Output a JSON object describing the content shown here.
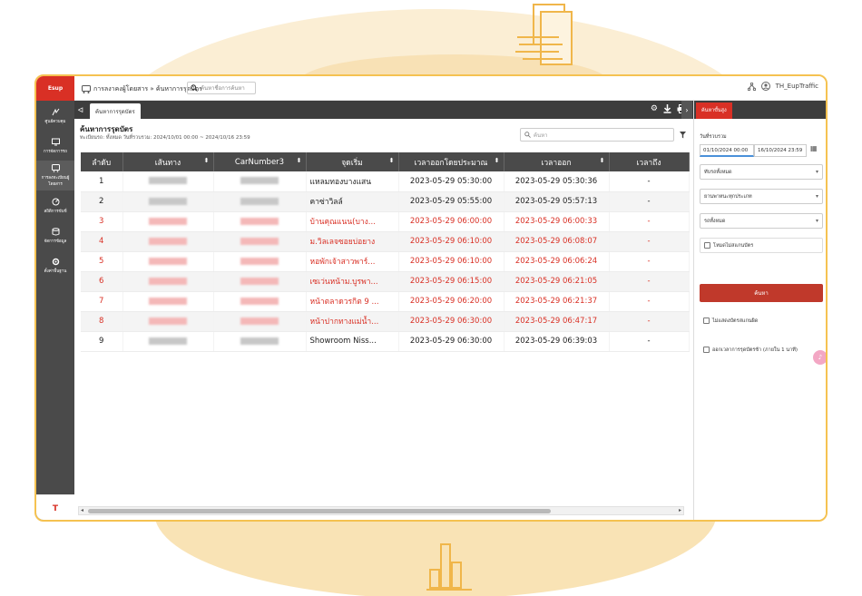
{
  "app": {
    "logo": "Esup",
    "breadcrumb": "การลงาคงผู้โดยสาร » ค้นหาการรุดบัตร",
    "top_search_placeholder": "ค้นหาชื่อการค้นหา",
    "user": "TH_EupTraffic"
  },
  "sidebar": {
    "items": [
      {
        "label": "ศูนย์ควบคุม",
        "icon": "tracking-icon"
      },
      {
        "label": "การจัดการรถ",
        "icon": "monitor-icon"
      },
      {
        "label": "การลงทะเบียนผู้โดยสาร",
        "icon": "bus-icon"
      },
      {
        "label": "สถิติการขับขี่",
        "icon": "stats-icon"
      },
      {
        "label": "จัดการข้อมูล",
        "icon": "database-icon"
      },
      {
        "label": "ตั้งค่าพื้นฐาน",
        "icon": "settings-icon"
      }
    ],
    "bottom_icon": "T"
  },
  "tabs": {
    "toggle": "ᐊ",
    "active_tab": "ค้นหาการรุดบัตร"
  },
  "content": {
    "title": "ค้นหาการรุดบัตร",
    "subtitle": "ทะเบียนรถ: ทั้งหมด   วันที่รวบรวม: 2024/10/01 00:00 ~ 2024/10/16 23:59",
    "table_search_placeholder": "ค้นหา",
    "table": {
      "headers": [
        "ลำดับ",
        "เส้นทาง",
        "CarNumber3",
        "จุดเริ่ม",
        "เวลาออกโดยประมาณ",
        "เวลาออก",
        "เวลาถึง"
      ],
      "rows": [
        {
          "no": "1",
          "start": "แหลมทองบางแสน",
          "est": "2023-05-29 05:30:00",
          "dep": "2023-05-29 05:30:36",
          "arr": "-",
          "alert": false
        },
        {
          "no": "2",
          "start": "คาซ่าวิลล์",
          "est": "2023-05-29 05:55:00",
          "dep": "2023-05-29 05:57:13",
          "arr": "-",
          "alert": false
        },
        {
          "no": "3",
          "start": "บ้านคุณแนน(บาง...",
          "est": "2023-05-29 06:00:00",
          "dep": "2023-05-29 06:00:33",
          "arr": "-",
          "alert": true
        },
        {
          "no": "4",
          "start": "ม.วิลเลจซอยบ่อยาง",
          "est": "2023-05-29 06:10:00",
          "dep": "2023-05-29 06:08:07",
          "arr": "-",
          "alert": true
        },
        {
          "no": "5",
          "start": "หอพักเจ้าสาวพาร์...",
          "est": "2023-05-29 06:10:00",
          "dep": "2023-05-29 06:06:24",
          "arr": "-",
          "alert": true
        },
        {
          "no": "6",
          "start": "เซเว่นหน้าม.บูรพา...",
          "est": "2023-05-29 06:15:00",
          "dep": "2023-05-29 06:21:05",
          "arr": "-",
          "alert": true
        },
        {
          "no": "7",
          "start": "หน้าตลาดวรกิต 9 ...",
          "est": "2023-05-29 06:20:00",
          "dep": "2023-05-29 06:21:37",
          "arr": "-",
          "alert": true
        },
        {
          "no": "8",
          "start": "หน้าปากทางแม่น้ำ...",
          "est": "2023-05-29 06:30:00",
          "dep": "2023-05-29 06:47:17",
          "arr": "-",
          "alert": true
        },
        {
          "no": "9",
          "start": "Showroom Niss...",
          "est": "2023-05-29 06:30:00",
          "dep": "2023-05-29 06:39:03",
          "arr": "-",
          "alert": false
        }
      ]
    }
  },
  "right_panel": {
    "tab": "ค้นหาขั้นสูง",
    "date_label": "วันที่รวบรวม",
    "date_from": "01/10/2024 00:00",
    "date_to": "16/10/2024 23:59",
    "select_vehicle": "ทับรถทั้งหมด",
    "select_type": "ยานพาหนะทุกประเภท",
    "select_route": "รถทั้งหมด",
    "check_unscanned": "โหมดไม่สแกนบัตร",
    "search_button": "ค้นหา",
    "check_hide_unscanned": "ไม่แสดงบัตรสแกนผิด",
    "check_late": "ออกเวลาการรุดบัตรช้า (ภายใน 1 นาที)"
  },
  "colors": {
    "accent": "#d93025",
    "sidebar": "#4a4a4a",
    "frame_border": "#f5c251"
  }
}
